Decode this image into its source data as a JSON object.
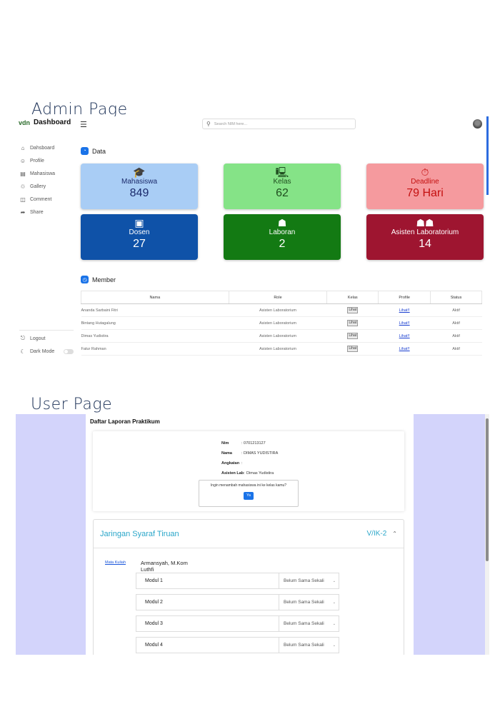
{
  "headings": {
    "admin": "Admin Page",
    "user": "User Page"
  },
  "admin": {
    "brand": {
      "logo": "vdn",
      "title": "Dashboard"
    },
    "nav": [
      {
        "icon": "home-icon",
        "glyph": "⌂",
        "label": "Dahsboard"
      },
      {
        "icon": "profile-icon",
        "glyph": "☺",
        "label": "Profile"
      },
      {
        "icon": "mahasiswa-icon",
        "glyph": "▤",
        "label": "Mahasiswa"
      },
      {
        "icon": "gallery-icon",
        "glyph": "♲",
        "label": "Gallery"
      },
      {
        "icon": "comment-icon",
        "glyph": "◫",
        "label": "Comment"
      },
      {
        "icon": "share-icon",
        "glyph": "➦",
        "label": "Share"
      }
    ],
    "logout": "Logout",
    "dark_mode": "Dark Mode",
    "search_placeholder": "Search NIM here...",
    "data_title": "Data",
    "member_title": "Member",
    "cards": [
      {
        "label": "Mahasiswa",
        "value": "849",
        "icon": "graduation-cap-icon",
        "glyph": "🎓",
        "bg": "#a9cdf5",
        "fg": "#1b2a6b"
      },
      {
        "label": "Kelas",
        "value": "62",
        "icon": "computer-icon",
        "glyph": "🖳",
        "bg": "#85e387",
        "fg": "#1f4d1f"
      },
      {
        "label": "Deadline",
        "value": "79 Hari",
        "icon": "stopwatch-icon",
        "glyph": "⏱",
        "bg": "#f59a9e",
        "fg": "#c41010"
      },
      {
        "label": "Dosen",
        "value": "27",
        "icon": "teacher-icon",
        "glyph": "▣",
        "bg": "#0f52a8",
        "fg": "#ffffff"
      },
      {
        "label": "Laboran",
        "value": "2",
        "icon": "user-gear-icon",
        "glyph": "☗",
        "bg": "#137a13",
        "fg": "#ffffff"
      },
      {
        "label": "Asisten Laboratorium",
        "value": "14",
        "icon": "users-gear-icon",
        "glyph": "☗☗",
        "bg": "#9e1530",
        "fg": "#ffffff"
      }
    ],
    "table": {
      "headers": [
        "Nama",
        "Role",
        "Kelas",
        "Profile",
        "Status"
      ],
      "rows": [
        {
          "nama": "Ananda Sarbaini Fitri",
          "role": "Asisten Laboratorium",
          "kelas": "Lihat",
          "profile": "Lihat!!",
          "status": "Aktif"
        },
        {
          "nama": "Bintang Hutagalung",
          "role": "Asisten Laboratorium",
          "kelas": "Lihat",
          "profile": "Lihat!!",
          "status": "Aktif"
        },
        {
          "nama": "Dimas Yudistira",
          "role": "Asisten Laboratorium",
          "kelas": "Lihat",
          "profile": "Lihat!!",
          "status": "Aktif"
        },
        {
          "nama": "Fatur Rahman",
          "role": "Asisten Laboratorium",
          "kelas": "Lihat",
          "profile": "Lihat!!",
          "status": "Aktif"
        }
      ]
    }
  },
  "user": {
    "title": "Daftar Laporan Praktikum",
    "info": [
      {
        "key": "Nim",
        "value": ": 0701213127"
      },
      {
        "key": "Nama",
        "value": ": DIMAS YUDISTIRA"
      },
      {
        "key": "Angkatan",
        "value": ":"
      },
      {
        "key": "Asisten Lab",
        "value": ": Dimas Yudistira"
      }
    ],
    "confirm_text": "Ingin menambah mahasiswa ini ke kelas kamu?",
    "confirm_button": "Ya",
    "course": {
      "name": "Jaringan Syaraf Tiruan",
      "code": "V/IK-2",
      "image_alt": "Mata Kuliah",
      "lecturer1": "Armansyah, M.Kom",
      "lecturer2": "Luthfi",
      "modules": [
        {
          "name": "Modul 1",
          "status": "Belum Sama Sekali"
        },
        {
          "name": "Modul 2",
          "status": "Belum Sama Sekali"
        },
        {
          "name": "Modul 3",
          "status": "Belum Sama Sekali"
        },
        {
          "name": "Modul 4",
          "status": "Belum Sama Sekali"
        }
      ]
    }
  }
}
